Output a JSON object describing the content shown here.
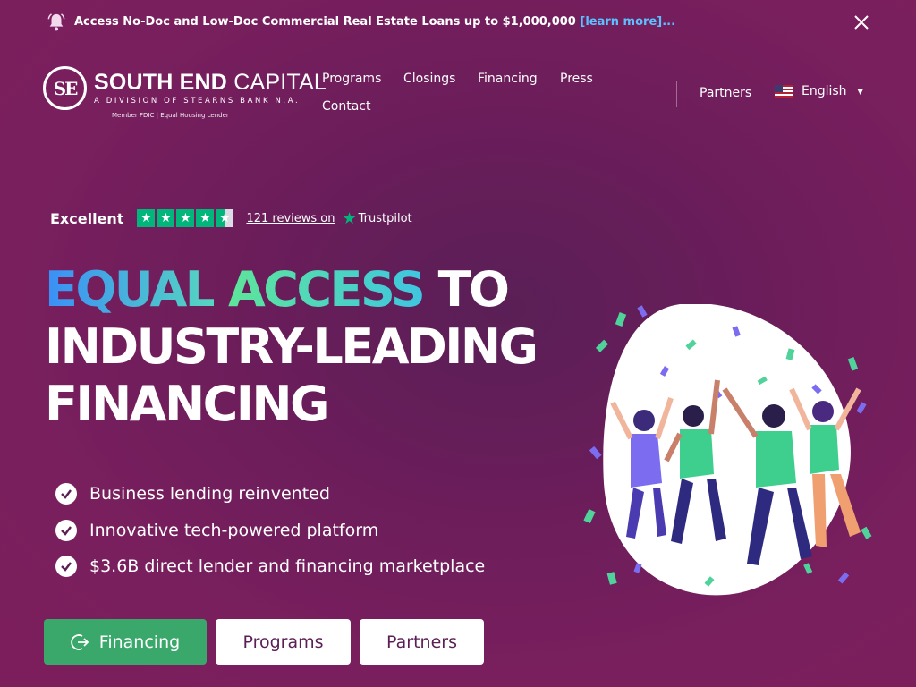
{
  "announcement": {
    "text": "Access No-Doc and Low-Doc Commercial Real Estate Loans up to $1,000,000",
    "link": "[learn more]...",
    "icon": "bell-icon",
    "close_icon": "close-icon"
  },
  "header": {
    "logo_mark": "SE",
    "brand_bold": "SOUTH END",
    "brand_light": "CAPITAL",
    "division": "A DIVISION OF STEARNS BANK N.A.",
    "fdic": "Member FDIC  |  Equal Housing Lender",
    "nav": [
      "Programs",
      "Closings",
      "Financing",
      "Press",
      "Contact"
    ],
    "partners": "Partners",
    "language": "English"
  },
  "trustpilot": {
    "rating_text": "Excellent",
    "reviews": "121 reviews on",
    "brand": "Trustpilot",
    "stars": 4.5
  },
  "hero": {
    "headline_accent_1": "EQUAL",
    "headline_accent_2": "ACCESS",
    "headline_rest_1": "TO",
    "headline_line_2": "INDUSTRY-LEADING",
    "headline_line_3": "FINANCING",
    "bullets": [
      "Business lending reinvented",
      "Innovative tech-powered platform",
      "$3.6B direct lender and financing marketplace"
    ],
    "buttons": {
      "financing": "Financing",
      "programs": "Programs",
      "partners": "Partners"
    }
  },
  "colors": {
    "background": "#6a1d5a",
    "primary_button": "#3aa86a",
    "trustpilot_green": "#00b67a",
    "link_blue": "#5bc0ff"
  }
}
